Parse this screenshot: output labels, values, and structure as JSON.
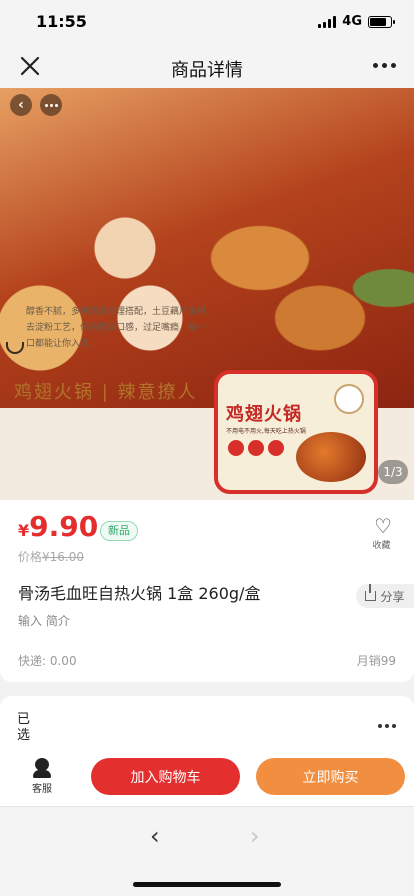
{
  "status_bar": {
    "time": "11:55",
    "network": "4G"
  },
  "nav": {
    "title": "商品详情"
  },
  "gallery": {
    "counter": "1/3",
    "description": "醇香不腻，多种蔬菜合理搭配，土豆藕片采用去淀粉工艺，保持脆爽口感，过足嘴瘾，每一口都能让你入魂",
    "slogan": "鸡翅火锅 | 辣意撩人",
    "package_title": "鸡翅火锅",
    "package_subtitle": "不用电不用火,每天吃上热火锅"
  },
  "product": {
    "currency": "¥",
    "price": "9.90",
    "tag": "新品",
    "original_price_label": "价格",
    "original_price": "¥16.00",
    "title": "骨汤毛血旺自热火锅 1盒 260g/盒",
    "intro": "输入 简介",
    "shipping": "快递: 0.00",
    "monthly_sales": "月销99",
    "favorite_label": "收藏",
    "share_label": "分享"
  },
  "selection": {
    "label": "已选"
  },
  "actions": {
    "service_label": "客服",
    "add_to_cart": "加入购物车",
    "buy_now": "立即购买"
  },
  "browser": {
    "back": "‹",
    "forward": "›"
  },
  "colors": {
    "accent_red": "#e42f2f",
    "accent_orange": "#f18e3f",
    "new_tag_green": "#2ba56a"
  }
}
